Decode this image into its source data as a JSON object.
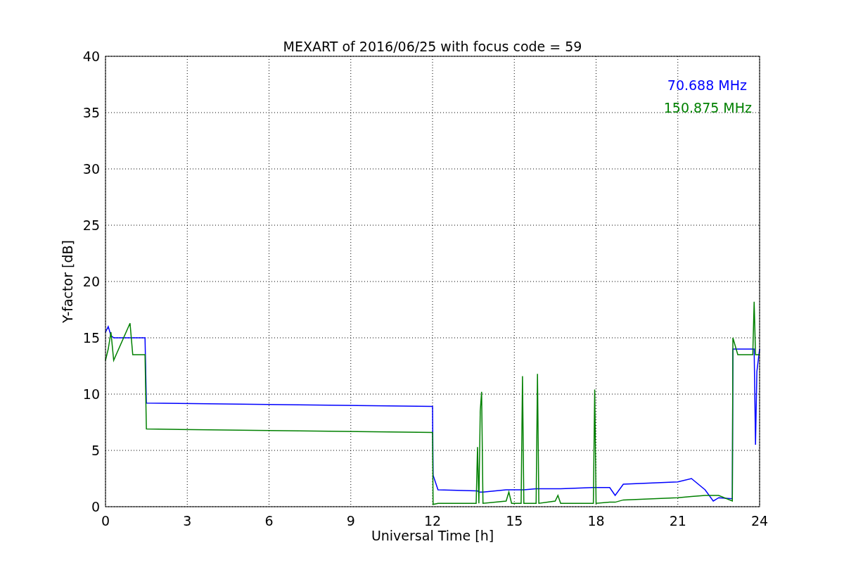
{
  "chart_data": {
    "type": "line",
    "title": "MEXART of 2016/06/25 with focus code = 59",
    "xlabel": "Universal Time [h]",
    "ylabel": "Y-factor [dB]",
    "x": [
      0,
      0.1,
      0.2,
      0.3,
      0.9,
      1.0,
      1.45,
      1.5,
      12,
      12.02,
      12.2,
      13.6,
      13.65,
      13.7,
      13.75,
      13.8,
      13.85,
      14.7,
      14.8,
      14.9,
      15.25,
      15.3,
      15.35,
      15.8,
      15.85,
      15.9,
      16.5,
      16.6,
      16.7,
      17.9,
      17.95,
      18.0,
      18.5,
      18.7,
      19,
      21,
      21.5,
      22,
      22.3,
      22.5,
      23,
      23.02,
      23.2,
      23.75,
      23.8,
      23.85,
      23.9,
      24
    ],
    "series": [
      {
        "name": "70.688 MHz",
        "color": "#0000ff",
        "values": [
          15.5,
          16,
          15.2,
          15,
          15,
          15,
          15,
          9.2,
          8.9,
          2.8,
          1.5,
          1.4,
          1.4,
          1.3,
          1.3,
          1.3,
          1.3,
          1.5,
          1.5,
          1.5,
          1.5,
          1.5,
          1.5,
          1.6,
          1.6,
          1.6,
          1.6,
          1.6,
          1.6,
          1.7,
          1.7,
          1.7,
          1.7,
          1.0,
          2.0,
          2.2,
          2.5,
          1.5,
          0.5,
          0.8,
          0.7,
          14,
          14,
          14,
          14,
          5.5,
          12,
          14
        ]
      },
      {
        "name": "150.875 MHz",
        "color": "#008000",
        "values": [
          13,
          14,
          15.5,
          13,
          16.3,
          13.5,
          13.5,
          6.9,
          6.6,
          0.2,
          0.3,
          0.3,
          5.3,
          0.3,
          8.5,
          10.2,
          0.3,
          0.5,
          1.3,
          0.3,
          0.3,
          11.6,
          0.3,
          0.3,
          11.8,
          0.3,
          0.5,
          1.0,
          0.3,
          0.3,
          10.4,
          0.3,
          0.4,
          0.4,
          0.6,
          0.8,
          0.9,
          1.0,
          1.0,
          1.0,
          0.5,
          15,
          13.5,
          13.5,
          18.2,
          13.5,
          13.5,
          13.5
        ]
      }
    ],
    "xlim": [
      0,
      24
    ],
    "ylim": [
      0,
      40
    ],
    "xticks": [
      0,
      3,
      6,
      9,
      12,
      15,
      18,
      21,
      24
    ],
    "yticks": [
      0,
      5,
      10,
      15,
      20,
      25,
      30,
      35,
      40
    ],
    "grid": true
  }
}
